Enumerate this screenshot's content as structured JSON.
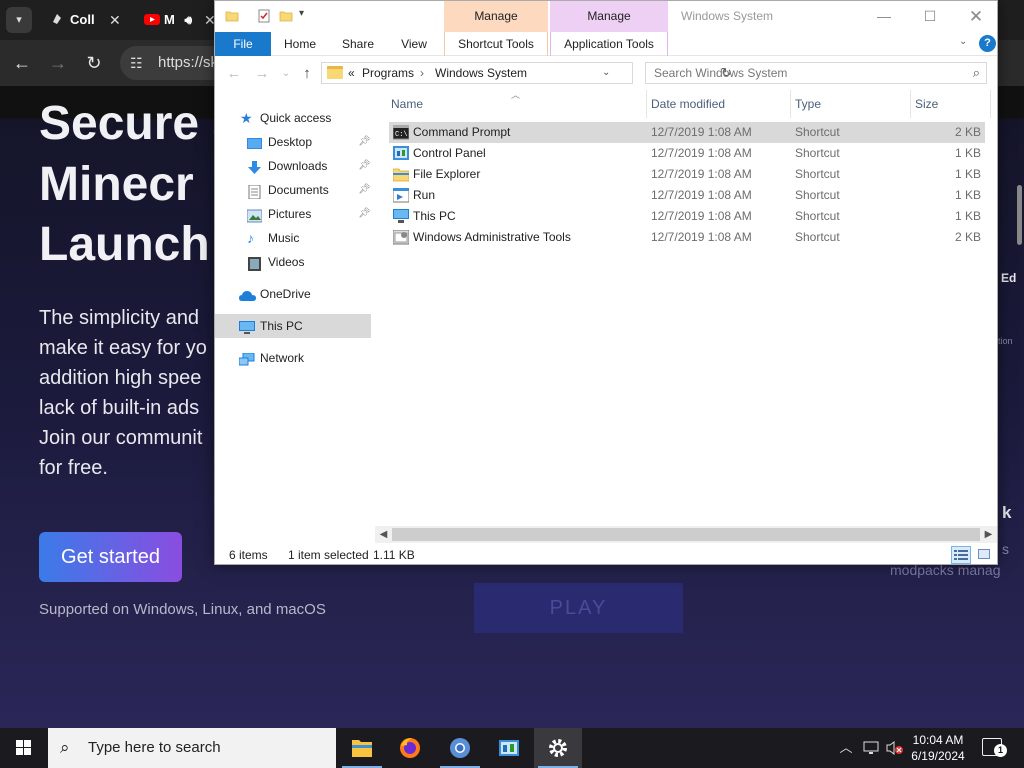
{
  "browser": {
    "tabs": [
      {
        "label": "Coll",
        "close": "✕"
      },
      {
        "label": "M",
        "close": "✕"
      }
    ],
    "url": "https://sk",
    "page": {
      "hero_line1": "Secure a",
      "hero_line2": "Minecr",
      "hero_line3": "Launch",
      "para": [
        "The simplicity and",
        "make it easy for yo",
        "addition high spee",
        "lack of built-in ads",
        "Join our communit",
        "for free."
      ],
      "cta": "Get started",
      "supported": "Supported on Windows, Linux, and macOS",
      "play": "PLAY",
      "modpacks": "modpacks manag",
      "right_ed": "Ed",
      "right_k": "k",
      "right_s": "s",
      "right_tion": "tion"
    }
  },
  "explorer": {
    "title": "Windows System",
    "manage1": "Manage",
    "manage2": "Manage",
    "ribbon": {
      "file": "File",
      "home": "Home",
      "share": "Share",
      "view": "View",
      "shortcut_tools": "Shortcut Tools",
      "application_tools": "Application Tools"
    },
    "address": {
      "prefix": "«",
      "part1": "Programs",
      "sep": "›",
      "part2": "Windows System"
    },
    "search_placeholder": "Search Windows System",
    "nav": {
      "quick_access": "Quick access",
      "desktop": "Desktop",
      "downloads": "Downloads",
      "documents": "Documents",
      "pictures": "Pictures",
      "music": "Music",
      "videos": "Videos",
      "onedrive": "OneDrive",
      "this_pc": "This PC",
      "network": "Network"
    },
    "columns": {
      "name": "Name",
      "date": "Date modified",
      "type": "Type",
      "size": "Size"
    },
    "files": [
      {
        "name": "Command Prompt",
        "date": "12/7/2019 1:08 AM",
        "type": "Shortcut",
        "size": "2 KB",
        "icon": "cmd-icon"
      },
      {
        "name": "Control Panel",
        "date": "12/7/2019 1:08 AM",
        "type": "Shortcut",
        "size": "1 KB",
        "icon": "control-panel-icon"
      },
      {
        "name": "File Explorer",
        "date": "12/7/2019 1:08 AM",
        "type": "Shortcut",
        "size": "1 KB",
        "icon": "folder-icon"
      },
      {
        "name": "Run",
        "date": "12/7/2019 1:08 AM",
        "type": "Shortcut",
        "size": "1 KB",
        "icon": "run-icon"
      },
      {
        "name": "This PC",
        "date": "12/7/2019 1:08 AM",
        "type": "Shortcut",
        "size": "1 KB",
        "icon": "this-pc-icon"
      },
      {
        "name": "Windows Administrative Tools",
        "date": "12/7/2019 1:08 AM",
        "type": "Shortcut",
        "size": "2 KB",
        "icon": "admin-tools-icon"
      }
    ],
    "status": {
      "count": "6 items",
      "selected": "1 item selected",
      "size": "1.11 KB"
    }
  },
  "taskbar": {
    "search_placeholder": "Type here to search",
    "time": "10:04 AM",
    "date": "6/19/2024",
    "notif_count": "1"
  },
  "colors": {
    "accent": "#1979ca",
    "selected_row": "#d9d9d9",
    "shortcut_tools_tab": "#fdd9c0",
    "application_tools_tab": "#efd0f5"
  }
}
